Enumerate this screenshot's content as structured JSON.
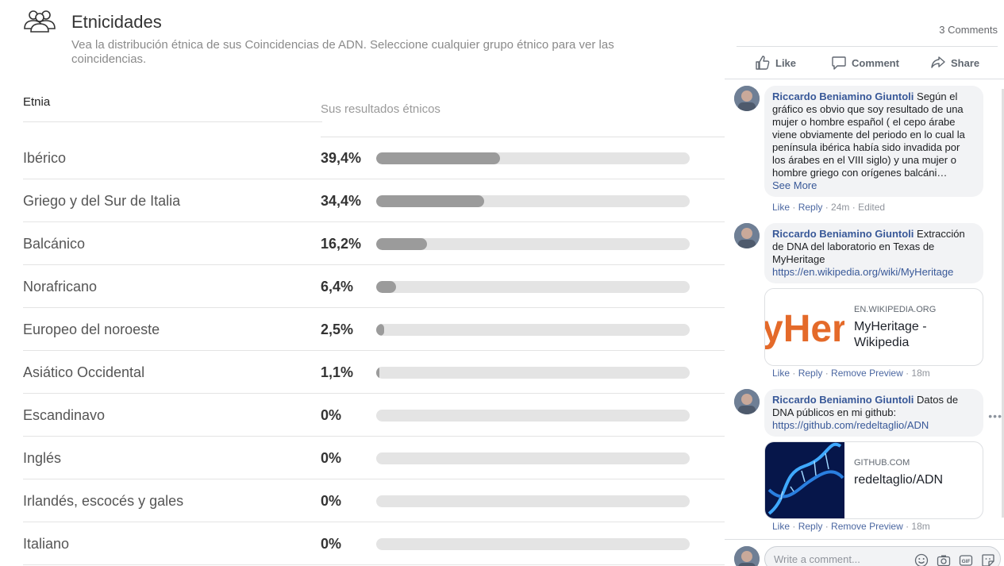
{
  "page": {
    "title": "Etnicidades",
    "subtitle": "Vea la distribución étnica de sus Coincidencias de ADN. Seleccione cualquier grupo étnico para ver las coincidencias.",
    "header_etnia": "Etnia",
    "header_results": "Sus resultados étnicos",
    "rows": [
      {
        "name": "Ibérico",
        "pct": "39,4%",
        "value": 39.4
      },
      {
        "name": "Griego y del Sur de Italia",
        "pct": "34,4%",
        "value": 34.4
      },
      {
        "name": "Balcánico",
        "pct": "16,2%",
        "value": 16.2
      },
      {
        "name": "Norafricano",
        "pct": "6,4%",
        "value": 6.4
      },
      {
        "name": "Europeo del noroeste",
        "pct": "2,5%",
        "value": 2.5
      },
      {
        "name": "Asiático Occidental",
        "pct": "1,1%",
        "value": 1.1
      },
      {
        "name": "Escandinavo",
        "pct": "0%",
        "value": 0
      },
      {
        "name": "Inglés",
        "pct": "0%",
        "value": 0
      },
      {
        "name": "Irlandés, escocés y gales",
        "pct": "0%",
        "value": 0
      },
      {
        "name": "Italiano",
        "pct": "0%",
        "value": 0
      }
    ]
  },
  "social": {
    "comments_count": "3 Comments",
    "like_label": "Like",
    "comment_label": "Comment",
    "share_label": "Share",
    "comments": [
      {
        "author": "Riccardo Beniamino Giuntoli",
        "text": " Según el gráfico es obvio que soy resultado de una mujer o hombre español ( el cepo árabe viene obviamente del periodo en lo cual la península ibérica había sido invadida por los árabes en el VIII siglo) y una mujer o hombre griego con orígenes balcáni…",
        "see_more": "See More",
        "like": "Like",
        "reply": "Reply",
        "time": "24m",
        "edited": "Edited"
      },
      {
        "author": "Riccardo Beniamino Giuntoli",
        "text": " Extracción de DNA del laboratorio en Texas de MyHeritage",
        "url": "https://en.wikipedia.org/wiki/MyHeritage",
        "preview_domain": "EN.WIKIPEDIA.ORG",
        "preview_title": "MyHeritage - Wikipedia",
        "preview_logo": "yHer",
        "like": "Like",
        "reply": "Reply",
        "remove": "Remove Preview",
        "time": "18m"
      },
      {
        "author": "Riccardo Beniamino Giuntoli",
        "text": " Datos de DNA públicos en mi github:",
        "url": "https://github.com/redeltaglio/ADN",
        "preview_domain": "GITHUB.COM",
        "preview_title": "redeltaglio/ADN",
        "like": "Like",
        "reply": "Reply",
        "remove": "Remove Preview",
        "time": "18m"
      }
    ],
    "composer_placeholder": "Write a comment..."
  },
  "colors": {
    "bar_fill": "#9b9b9b",
    "bar_track": "#e4e4e4",
    "link": "#385898"
  }
}
